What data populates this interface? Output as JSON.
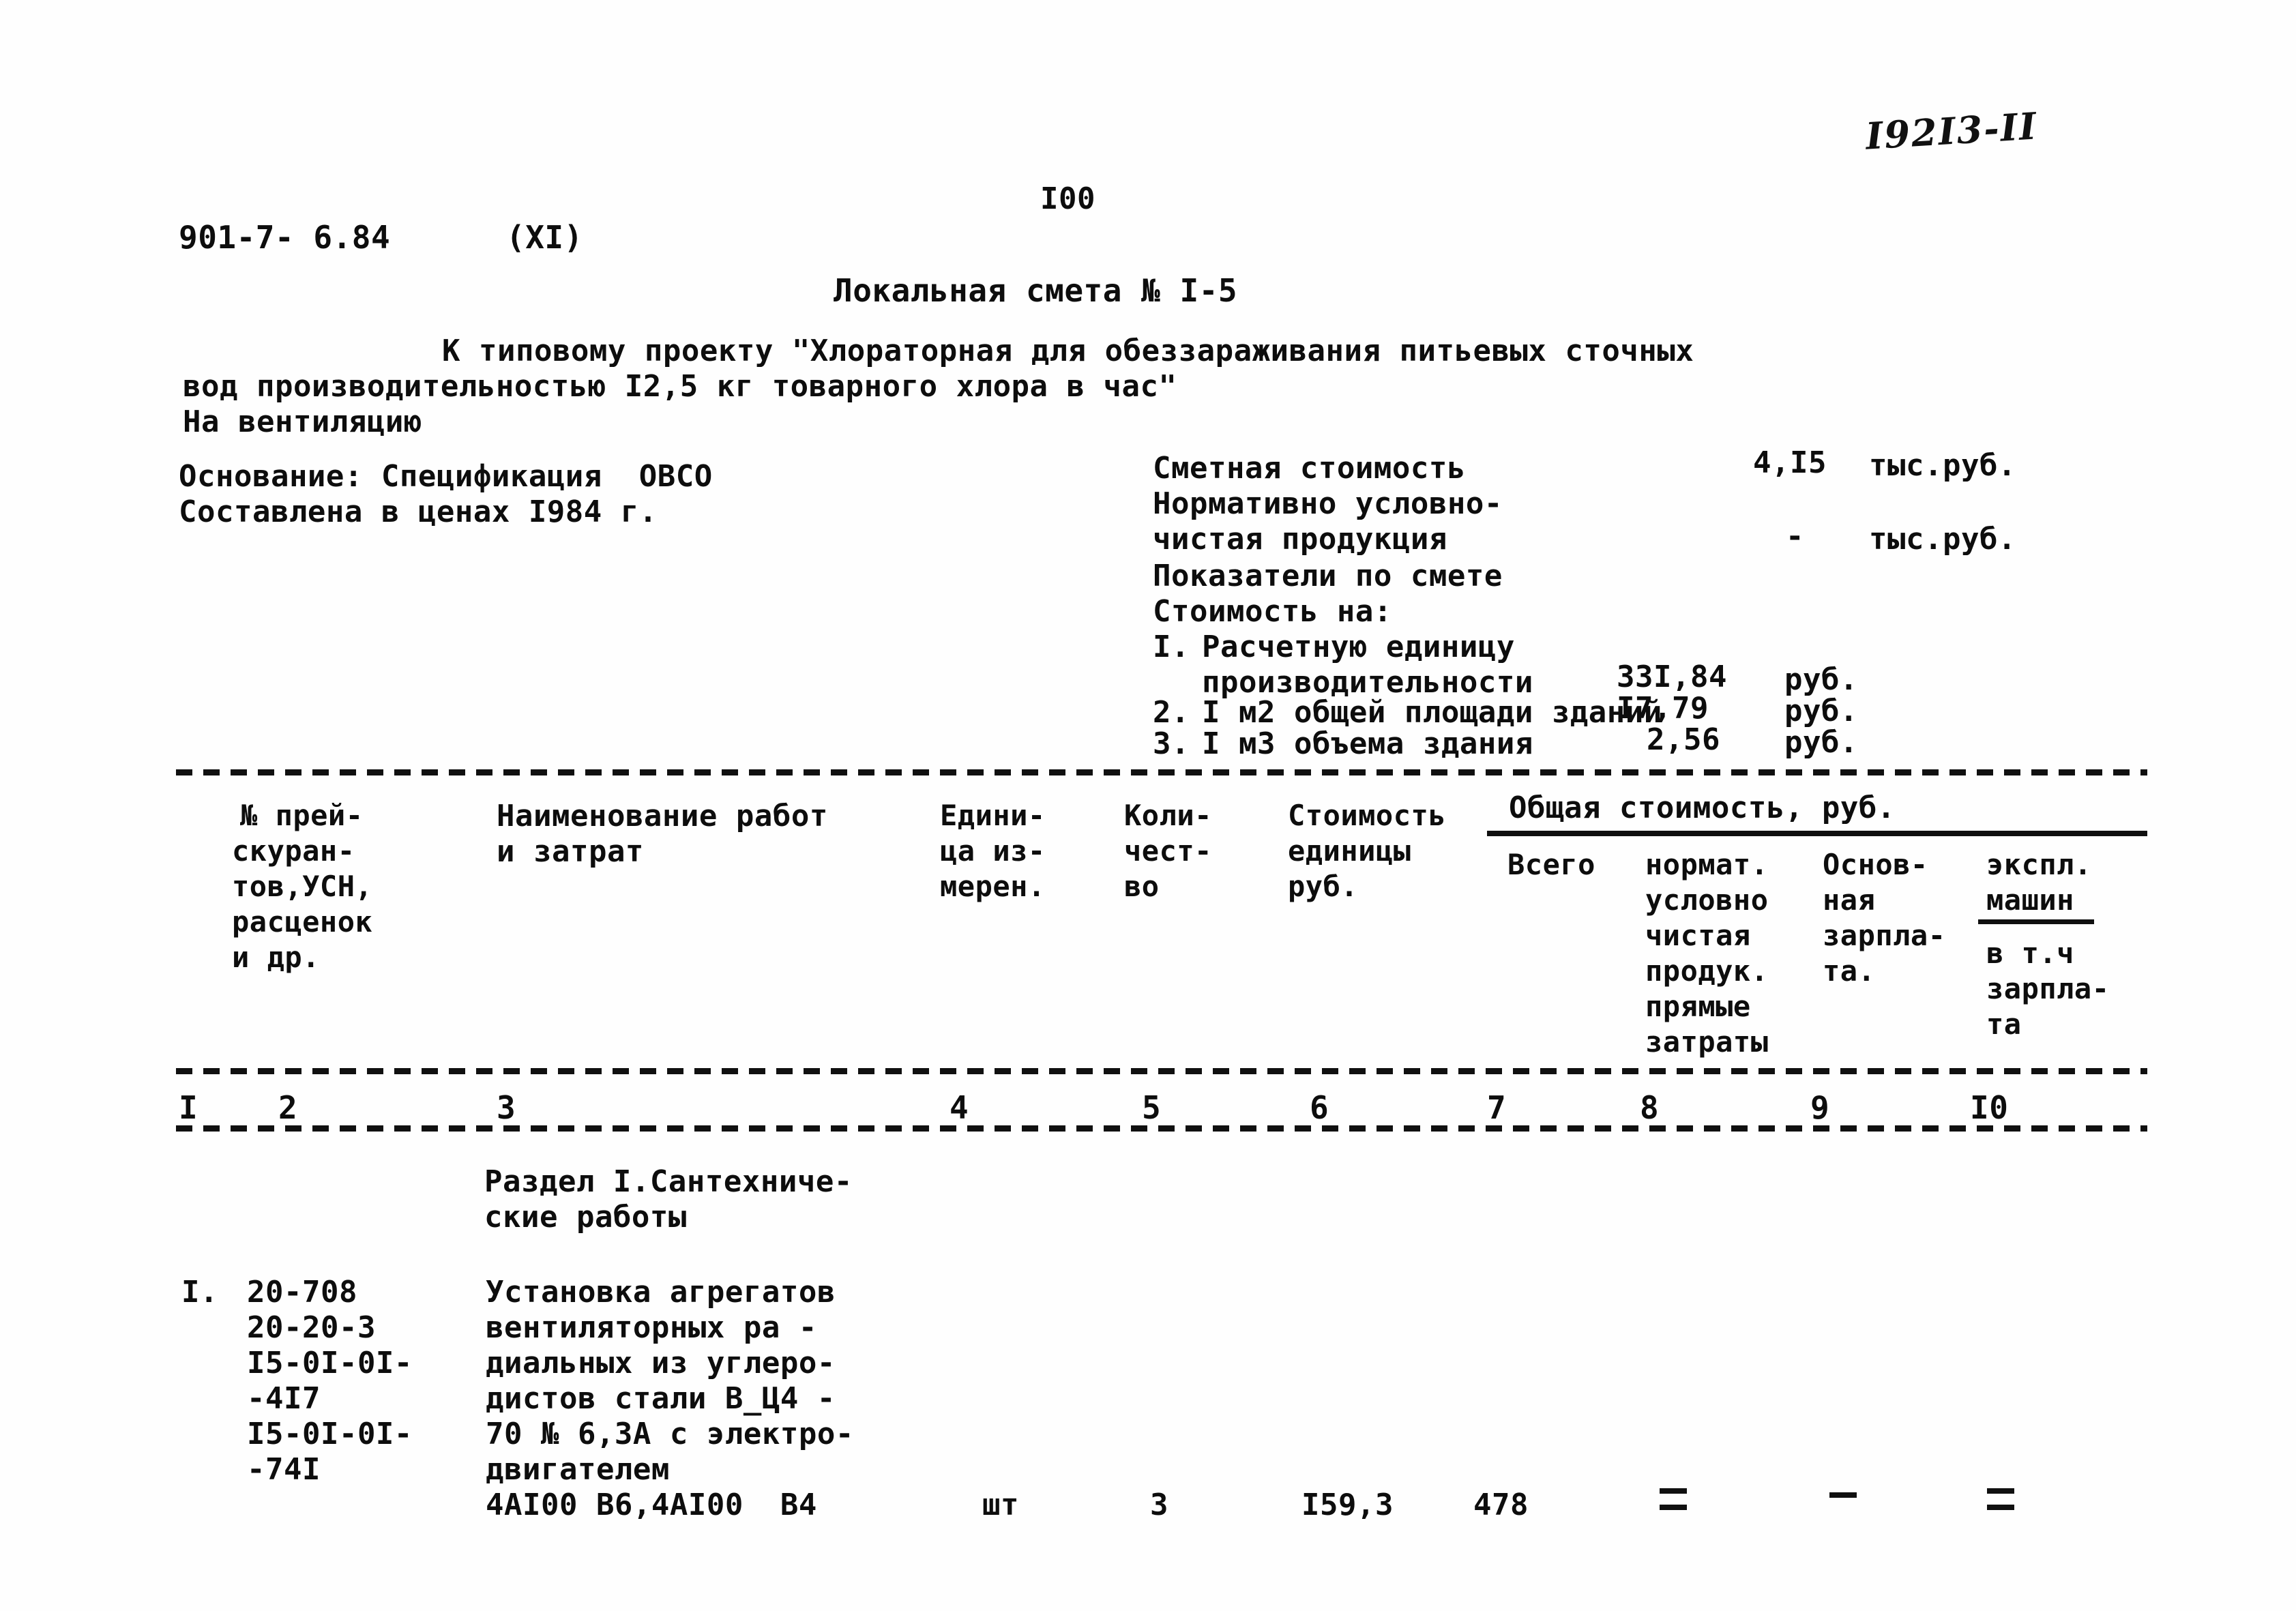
{
  "document": {
    "project_code": "901-7- 6.84",
    "series_marker": "(XI)",
    "page_number": "I00",
    "handwritten_archive_number": "I92I3-II",
    "title": "Локальная смета № I-5",
    "subtitle_line1": "К типовому проекту \"Хлораторная для обеззараживания питьевых сточных",
    "subtitle_line2": "вод производительностью I2,5 кг товарного хлора в час\"",
    "subtitle_line3": "На вентиляцию"
  },
  "basis": {
    "line1": "Основание: Спецификация  ОВСО",
    "line2": "Составлена в ценах I984 г."
  },
  "summary": {
    "estimate_cost_label": "Сметная стоимость",
    "estimate_cost_value": "4,I5",
    "estimate_cost_unit": "тыс.руб.",
    "net_product_label_line1": "Нормативно условно-",
    "net_product_label_line2": "чистая продукция",
    "net_product_value": "-",
    "net_product_unit": "тыс.руб.",
    "indicators_label": "Показатели по смете",
    "cost_for_label": "Стоимость на:",
    "items": [
      {
        "num": "I.",
        "label_line1": "Расчетную единицу",
        "label_line2": "производительности",
        "value": "33I,84",
        "unit": "руб."
      },
      {
        "num": "2.",
        "label_line1": "I м2 общей площади зданий",
        "label_line2": "",
        "value": "I7,79",
        "unit": "руб."
      },
      {
        "num": "3.",
        "label_line1": "I м3 объема здания",
        "label_line2": "",
        "value": "2,56",
        "unit": "руб."
      }
    ]
  },
  "table": {
    "headers": {
      "col1": [
        "№ прей-",
        "скуран-",
        "тов,УСН,",
        "расценок",
        "и др."
      ],
      "col2": [
        "Наименование работ",
        "и затрат"
      ],
      "col3": [
        "Едини-",
        "ца из-",
        "мерен."
      ],
      "col4": [
        "Коли-",
        "чест-",
        "во"
      ],
      "col5": [
        "Стоимость",
        "единицы",
        "руб."
      ],
      "group_label": "Общая стоимость, руб.",
      "col6": [
        "Всего"
      ],
      "col7": [
        "нормат.",
        "условно",
        "чистая",
        "продук.",
        "прямые",
        "затраты"
      ],
      "col8": [
        "Основ-",
        "ная",
        "зарпла-",
        "та."
      ],
      "col9": [
        "экспл.",
        "машин",
        "в т.ч",
        "зарпла-",
        "та"
      ]
    },
    "column_numbers": [
      "I",
      "2",
      "3",
      "4",
      "5",
      "6",
      "7",
      "8",
      "9",
      "I0"
    ],
    "section_heading": [
      "Раздел I.Сантехниче-",
      "ские работы"
    ],
    "rows": [
      {
        "row_number": "I.",
        "codes": [
          "20-708",
          "20-20-3",
          "I5-0I-0I-",
          "-4I7",
          "I5-0I-0I-",
          "-74I"
        ],
        "description": [
          "Установка агрегатов",
          "вентиляторных ра -",
          "диальных из углеро-",
          "дистов стали В_Ц4 -",
          "70 № 6,3А с электро-",
          "двигателем",
          "4АI00 В6,4АI00  В4"
        ],
        "unit": "шт",
        "quantity": "3",
        "unit_cost": "I59,3",
        "total": "478",
        "norm_net_product": "dash-over-dash",
        "basic_wage": "dash",
        "machine_operation": "dash-over-dash"
      }
    ]
  }
}
